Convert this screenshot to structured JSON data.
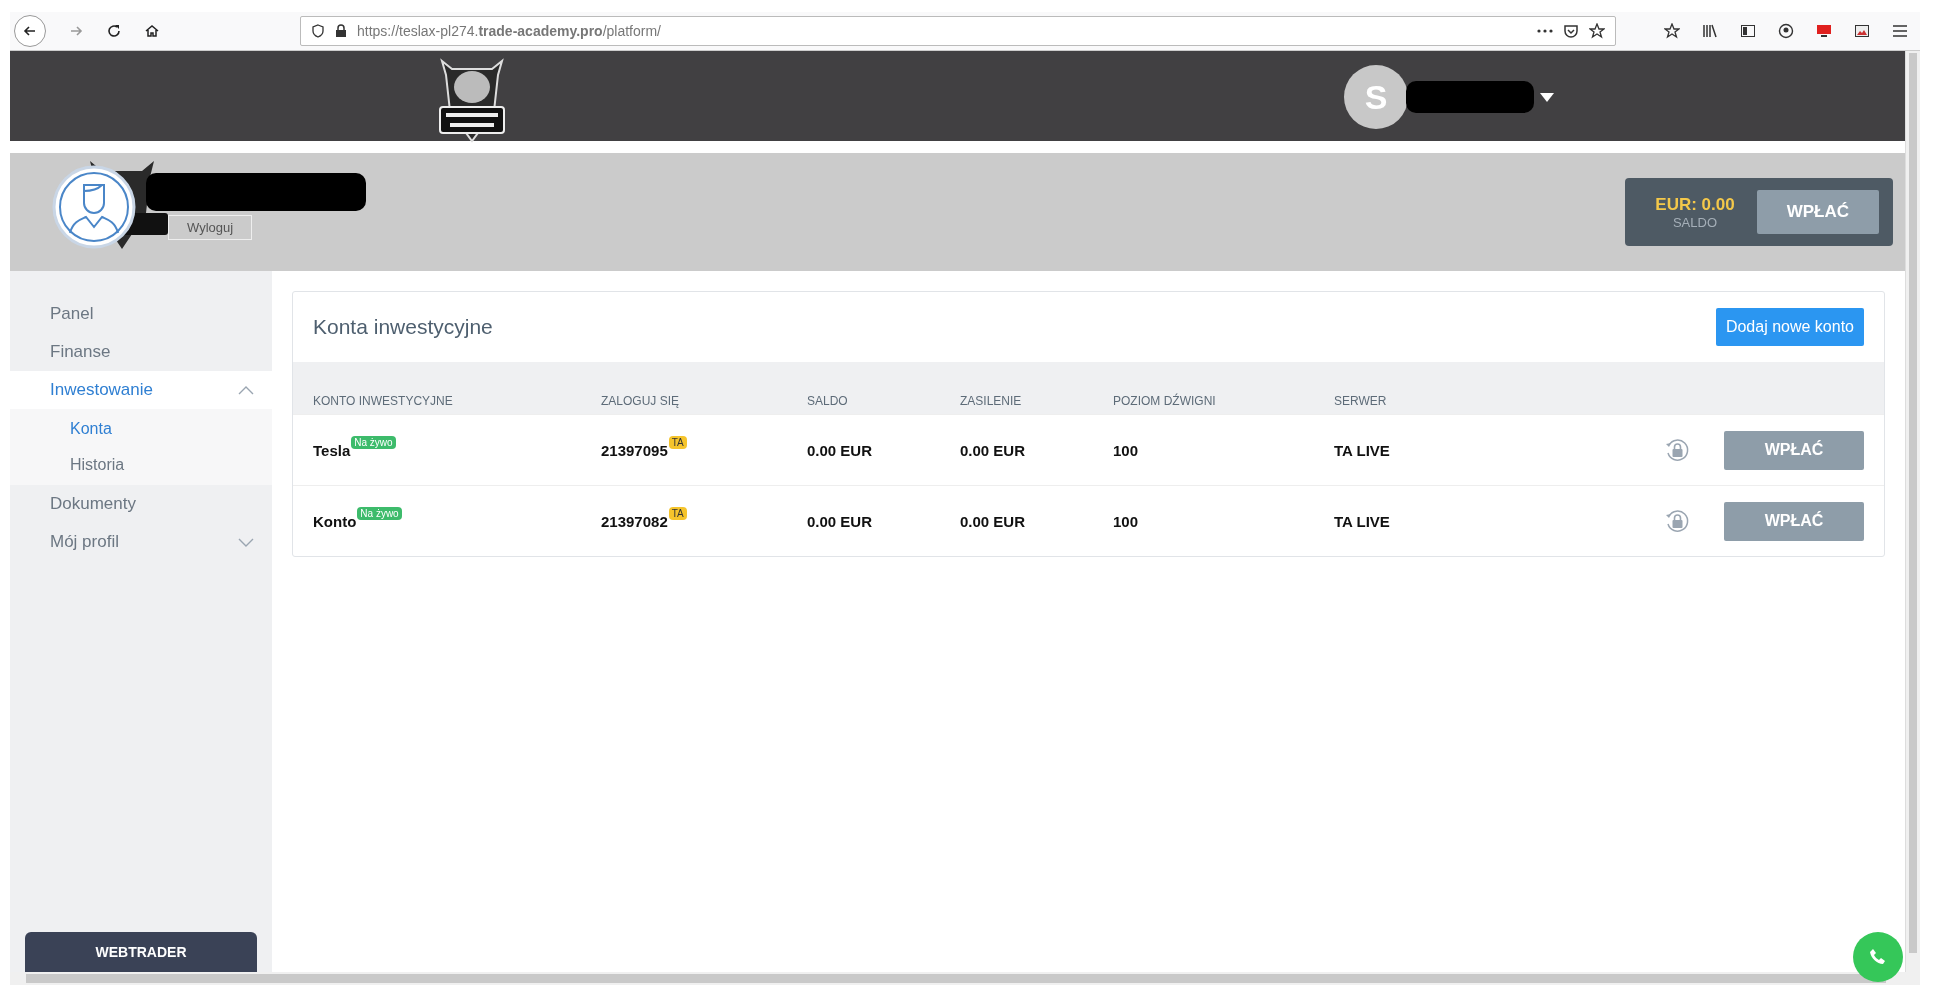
{
  "browser": {
    "url": "https://teslax-pl274.**trade-academy.pro**/platform/"
  },
  "topbar": {
    "avatar_letter": "S"
  },
  "profile": {
    "logout": "Wyloguj",
    "balance": "EUR: 0.00",
    "balance_label": "SALDO",
    "deposit": "WPŁAĆ"
  },
  "sidebar": {
    "items": [
      {
        "label": "Panel",
        "selected": false
      },
      {
        "label": "Finanse",
        "selected": false
      },
      {
        "label": "Inwestowanie",
        "selected": true,
        "expanded": true,
        "children": [
          {
            "label": "Konta",
            "selected": true
          },
          {
            "label": "Historia",
            "selected": false
          }
        ]
      },
      {
        "label": "Dokumenty",
        "selected": false
      },
      {
        "label": "Mój profil",
        "selected": false,
        "expanded": false
      }
    ],
    "webtrader": "WEBTRADER"
  },
  "accounts": {
    "title": "Konta inwestycyjne",
    "add_button": "Dodaj nowe konto",
    "columns": [
      "KONTO INWESTYCYJNE",
      "ZALOGUJ SIĘ",
      "SALDO",
      "ZASILENIE",
      "POZIOM DŹWIGNI",
      "SERWER"
    ],
    "rows": [
      {
        "name": "Tesla",
        "badge": "Na żywo",
        "login": "21397095",
        "login_badge": "TA",
        "balance": "0.00 EUR",
        "funding": "0.00 EUR",
        "leverage": "100",
        "server": "TA LIVE",
        "button": "WPŁAĆ"
      },
      {
        "name": "Konto",
        "badge": "Na żywo",
        "login": "21397082",
        "login_badge": "TA",
        "balance": "0.00 EUR",
        "funding": "0.00 EUR",
        "leverage": "100",
        "server": "TA LIVE",
        "button": "WPŁAĆ"
      }
    ]
  }
}
